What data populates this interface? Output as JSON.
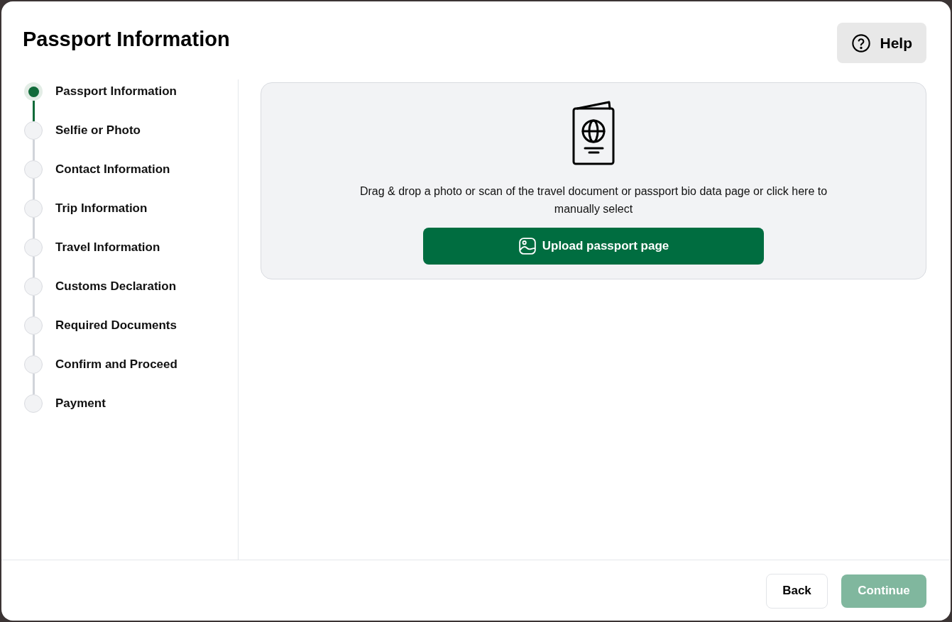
{
  "title": "Passport Information",
  "help_button": {
    "label": "Help"
  },
  "steps": [
    {
      "label": "Passport Information",
      "selected": true
    },
    {
      "label": "Selfie or Photo",
      "selected": false
    },
    {
      "label": "Contact Information",
      "selected": false
    },
    {
      "label": "Trip Information",
      "selected": false
    },
    {
      "label": "Travel Information",
      "selected": false
    },
    {
      "label": "Customs Declaration",
      "selected": false
    },
    {
      "label": "Required Documents",
      "selected": false
    },
    {
      "label": "Confirm and Proceed",
      "selected": false
    },
    {
      "label": "Payment",
      "selected": false
    }
  ],
  "upload": {
    "instructions": "Drag & drop a photo or scan of the travel document or passport bio data page or click here to manually select",
    "button": "Upload passport page"
  },
  "footer": {
    "back": {
      "label": "Back"
    },
    "continue": {
      "label": "Continue",
      "disabled": true
    }
  }
}
